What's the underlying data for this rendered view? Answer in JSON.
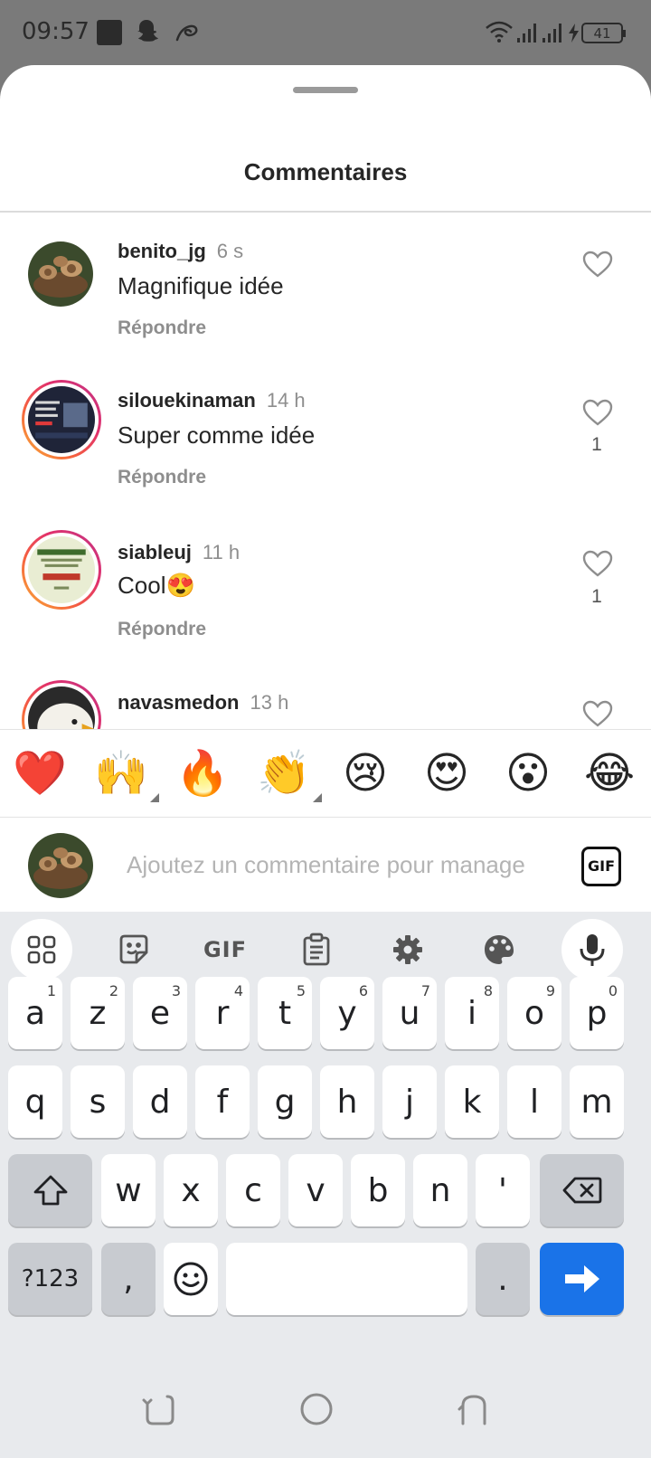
{
  "status_bar": {
    "time": "09:57",
    "battery": "41",
    "icons": [
      "app-square-icon",
      "snapchat-ghost-icon",
      "swirl-icon",
      "wifi-icon",
      "signal-icon",
      "signal-icon",
      "charging-bolt-icon",
      "battery-icon"
    ]
  },
  "sheet": {
    "title": "Commentaires"
  },
  "comments": [
    {
      "username": "benito_jg",
      "time": "6 s",
      "text": "Magnifique idée",
      "reply": "Répondre",
      "likes": ""
    },
    {
      "username": "silouekinaman",
      "time": "14 h",
      "text": "Super comme idée",
      "reply": "Répondre",
      "likes": "1"
    },
    {
      "username": "siableuj",
      "time": "11 h",
      "text": "Cool😍",
      "reply": "Répondre",
      "likes": "1"
    },
    {
      "username": "navasmedon",
      "time": "13 h",
      "text": "",
      "reply": "",
      "likes": ""
    }
  ],
  "reactions": [
    "❤️",
    "🙌",
    "🔥",
    "👏",
    "😢",
    "😍",
    "😮",
    "😂"
  ],
  "input": {
    "placeholder": "Ajoutez un commentaire pour manage",
    "gif_label": "GIF"
  },
  "keyboard": {
    "toolbar_gif": "GIF",
    "row1": [
      "a",
      "z",
      "e",
      "r",
      "t",
      "y",
      "u",
      "i",
      "o",
      "p"
    ],
    "row1_hints": [
      "1",
      "2",
      "3",
      "4",
      "5",
      "6",
      "7",
      "8",
      "9",
      "0"
    ],
    "row2": [
      "q",
      "s",
      "d",
      "f",
      "g",
      "h",
      "j",
      "k",
      "l",
      "m"
    ],
    "row3": [
      "w",
      "x",
      "c",
      "v",
      "b",
      "n",
      "'"
    ],
    "symbols": "?123",
    "comma": ",",
    "period": "."
  },
  "colors": {
    "accent_blue": "#1a73e8",
    "story_ring_start": "#f9b035",
    "story_ring_end": "#c13584",
    "heart_red": "#e0202a"
  }
}
